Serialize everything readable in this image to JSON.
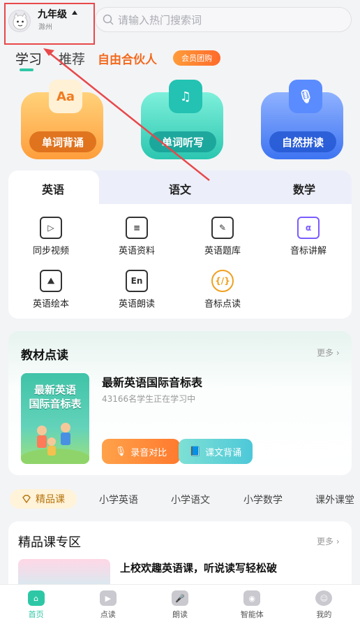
{
  "header": {
    "grade": "九年级",
    "city": "滁州",
    "search_placeholder": "请输入热门搜索词"
  },
  "top_tabs": {
    "learn": "学习",
    "recommend": "推荐",
    "partner": "自由合伙人",
    "group_buy": "会员团购"
  },
  "tiles": [
    {
      "label": "单词背诵",
      "icon": "Aa"
    },
    {
      "label": "单词听写",
      "icon": "♫"
    },
    {
      "label": "自然拼读",
      "icon": "🎙"
    }
  ],
  "subjects": {
    "english": "英语",
    "chinese": "语文",
    "math": "数学"
  },
  "english_items": [
    {
      "label": "同步视频",
      "icon": "▷"
    },
    {
      "label": "英语资料",
      "icon": "≡"
    },
    {
      "label": "英语题库",
      "icon": "✎"
    },
    {
      "label": "音标讲解",
      "icon": "α"
    },
    {
      "label": "英语绘本",
      "icon": "⛰"
    },
    {
      "label": "英语朗读",
      "icon": "En"
    },
    {
      "label": "音标点读",
      "icon": "{/}"
    }
  ],
  "textbook": {
    "title": "教材点读",
    "more": "更多 ›",
    "cover_line1": "最新英语",
    "cover_line2": "国际音标表",
    "book_title": "最新英语国际音标表",
    "learners": "43166名学生正在学习中",
    "btn_record": "录音对比",
    "btn_recite": "课文背诵"
  },
  "course_tabs": [
    "精品课",
    "小学英语",
    "小学语文",
    "小学数学",
    "课外课堂"
  ],
  "premium": {
    "title": "精品课专区",
    "more": "更多 ›",
    "course_title": "上校欢趣英语课，听说读写轻松破"
  },
  "bottom_nav": [
    {
      "label": "首页",
      "icon": "⌂"
    },
    {
      "label": "点读",
      "icon": "▶"
    },
    {
      "label": "朗读",
      "icon": "🎤"
    },
    {
      "label": "智能体",
      "icon": "◉"
    },
    {
      "label": "我的",
      "icon": "☺"
    }
  ],
  "colors": {
    "accent": "#2ec7a6",
    "partner": "#f26a1e",
    "annotation": "#e8484a"
  }
}
